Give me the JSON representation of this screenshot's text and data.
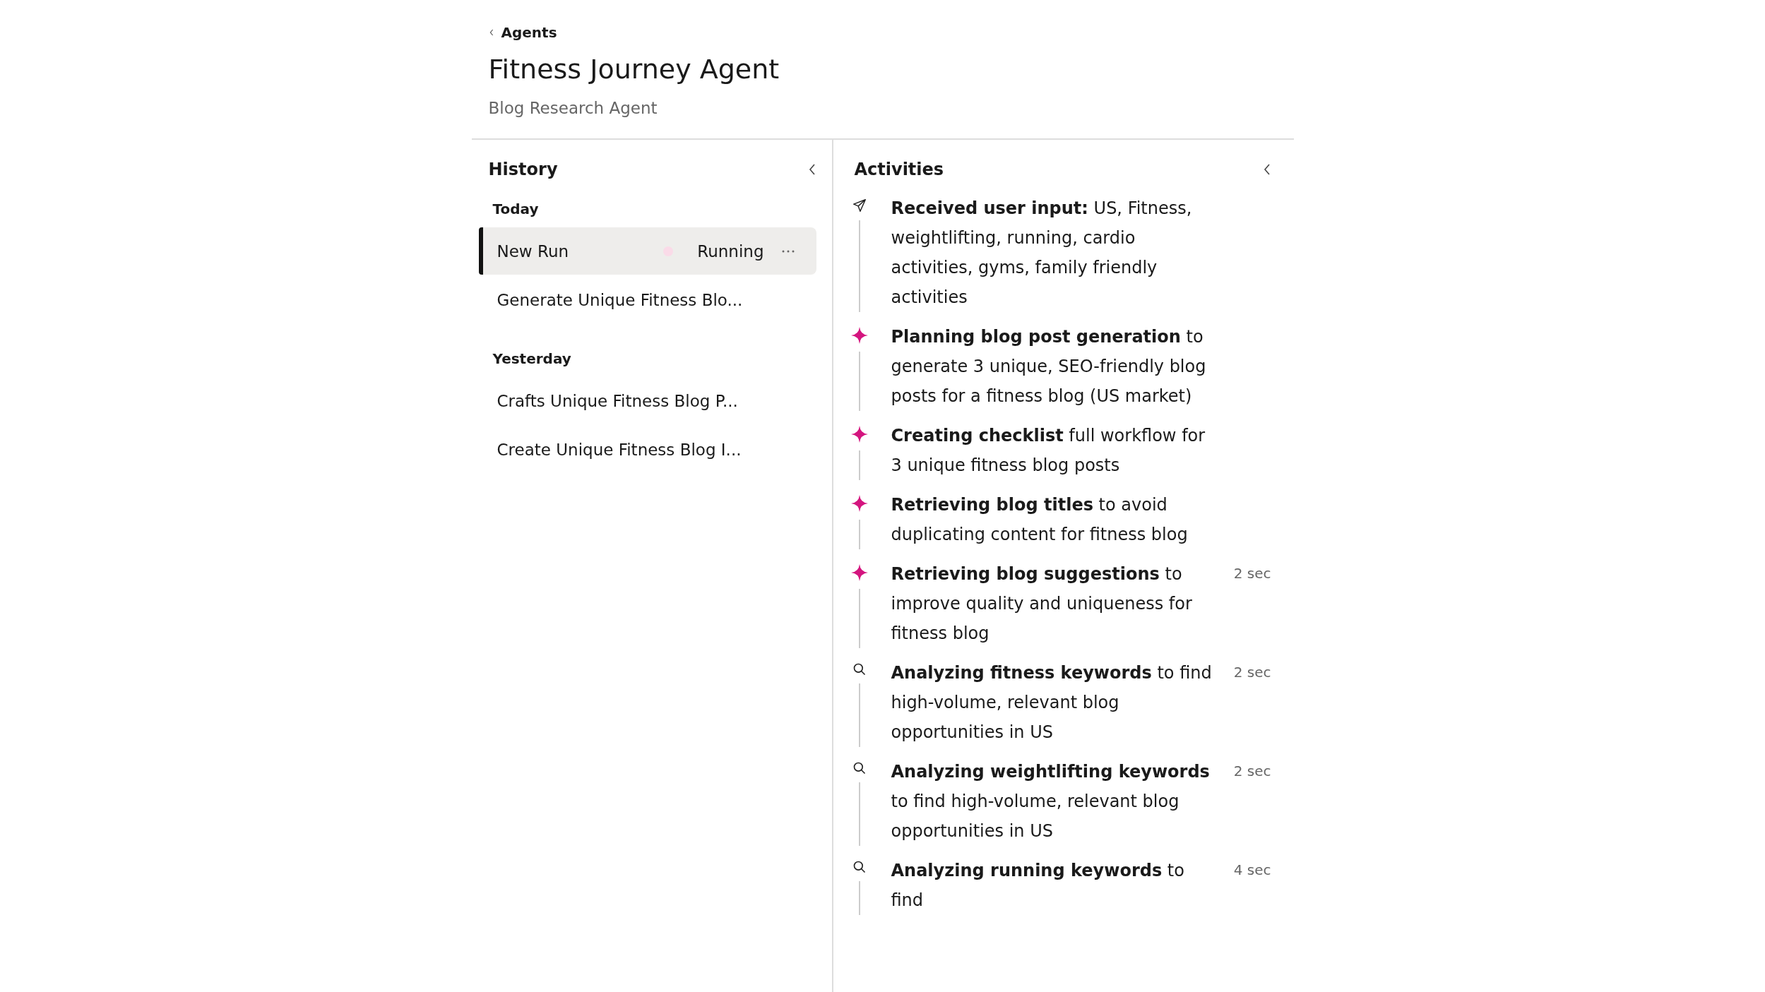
{
  "breadcrumb": {
    "label": "Agents"
  },
  "title": "Fitness Journey Agent",
  "subtitle": "Blog Research Agent",
  "history": {
    "title": "History",
    "groups": [
      {
        "label": "Today",
        "items": [
          {
            "label": "New Run",
            "selected": true,
            "status": "Running",
            "color": "#fadbe8"
          },
          {
            "label": "Generate Unique Fitness Blo...",
            "selected": false
          }
        ]
      },
      {
        "label": "Yesterday",
        "items": [
          {
            "label": "Crafts Unique Fitness Blog P...",
            "selected": false
          },
          {
            "label": "Create Unique Fitness Blog I...",
            "selected": false
          }
        ]
      }
    ]
  },
  "activities": {
    "title": "Activities",
    "items": [
      {
        "kind": "input",
        "text": "**Received user input:** US, Fitness, weightlifting, running, cardio activities, gyms, family friendly activities"
      },
      {
        "kind": "sparkle",
        "text": "**Planning blog post generation** to generate 3 unique, SEO-friendly blog posts for a fitness blog (US market)"
      },
      {
        "kind": "sparkle",
        "text": "**Creating checklist** full workflow for 3 unique fitness blog posts"
      },
      {
        "kind": "sparkle",
        "text": "**Retrieving blog titles** to avoid duplicating content for fitness blog"
      },
      {
        "kind": "sparkle",
        "text": "**Retrieving blog suggestions** to improve quality and uniqueness for fitness blog",
        "time": "2 sec"
      },
      {
        "kind": "search",
        "text": "**Analyzing fitness keywords** to find high-volume, relevant blog opportunities in US",
        "time": "2 sec"
      },
      {
        "kind": "search",
        "text": "**Analyzing weightlifting keywords** to find high-volume, relevant blog opportunities in US",
        "time": "2 sec"
      },
      {
        "kind": "search",
        "text": "**Analyzing running keywords** to find",
        "time": "4 sec"
      }
    ]
  }
}
